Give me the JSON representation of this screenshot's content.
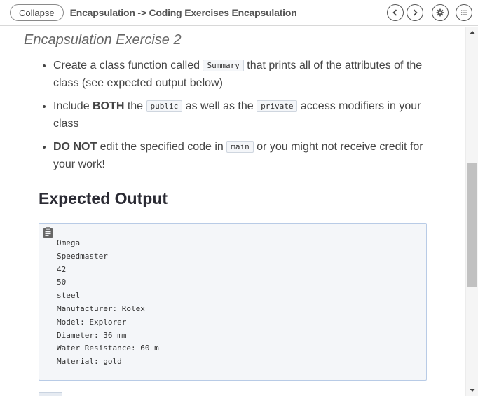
{
  "header": {
    "collapse_label": "Collapse",
    "breadcrumb": "Encapsulation -> Coding Exercises Encapsulation"
  },
  "icons": {
    "prev": "chevron-left-icon",
    "next": "chevron-right-icon",
    "settings": "gear-icon",
    "menu": "list-icon",
    "clipboard": "clipboard-icon"
  },
  "exercise": {
    "title": "Encapsulation Exercise 2",
    "bullets": [
      {
        "pre": "Create a class function called ",
        "code": "Summary",
        "post": " that prints all of the attributes of the class (see expected output below)"
      },
      {
        "pre": "Include ",
        "bold": "BOTH",
        "mid": " the ",
        "code1": "public",
        "mid2": " as well as the ",
        "code2": "private",
        "post": " access modifiers in your class"
      },
      {
        "bold": "DO NOT",
        "pre": " edit the specified code in ",
        "code": "main",
        "post": " or you might not receive credit for your work!"
      }
    ]
  },
  "expected": {
    "heading": "Expected Output",
    "lines": [
      "Omega",
      "Speedmaster",
      "42",
      "50",
      "steel",
      "Manufacturer: Rolex",
      "Model: Explorer",
      "Diameter: 36 mm",
      "Water Resistance: 60 m",
      "Material: gold"
    ]
  },
  "colors": {
    "code_bg": "#f4f6f9",
    "code_border": "#b8cbe6",
    "scroll_thumb": "#c1c1c1"
  }
}
